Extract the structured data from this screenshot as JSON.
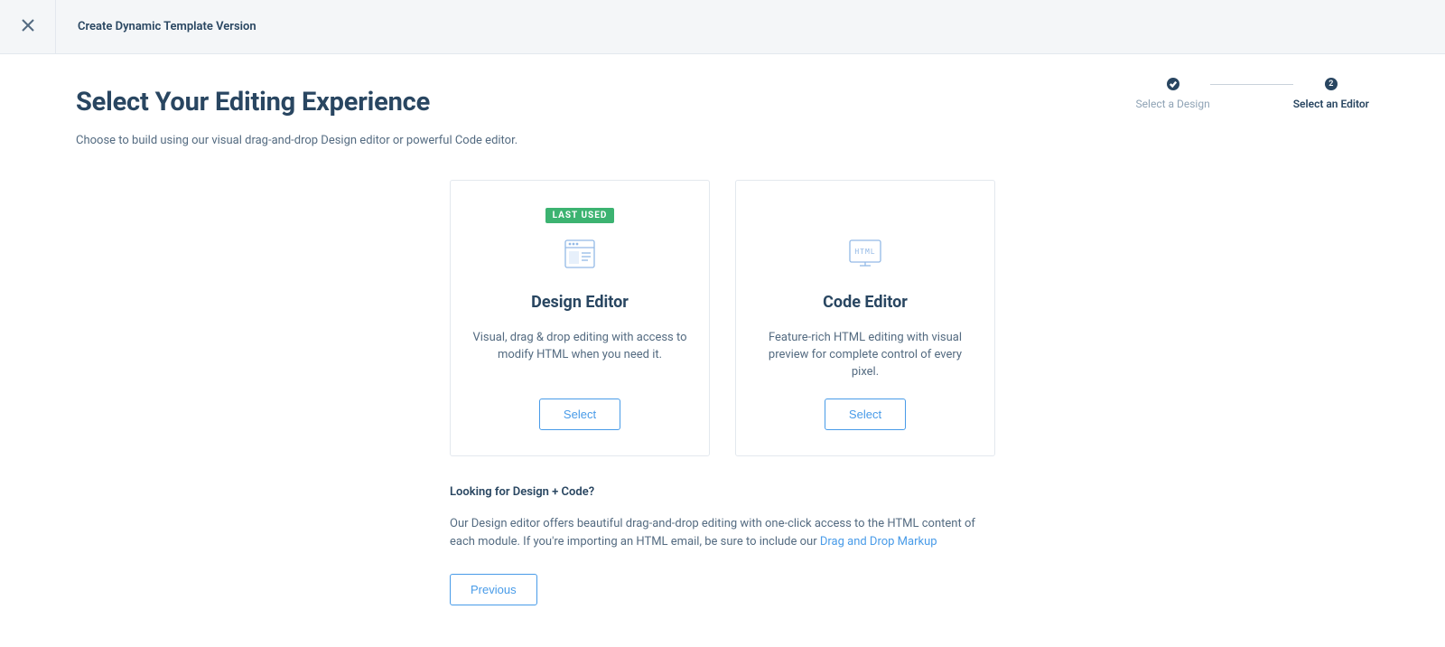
{
  "topbar": {
    "title": "Create Dynamic Template Version"
  },
  "page": {
    "heading": "Select Your Editing Experience",
    "subheading": "Choose to build using our visual drag-and-drop Design editor or powerful Code editor."
  },
  "stepper": {
    "step1": {
      "label": "Select a Design",
      "status": "done"
    },
    "step2": {
      "label": "Select an Editor",
      "status": "current",
      "number": "2"
    }
  },
  "cards": {
    "design": {
      "badge": "LAST USED",
      "title": "Design Editor",
      "description": "Visual, drag & drop editing with access to modify HTML when you need it.",
      "button": "Select"
    },
    "code": {
      "title": "Code Editor",
      "description": "Feature-rich HTML editing with visual preview for complete control of every pixel.",
      "button": "Select",
      "icon_text": "HTML"
    }
  },
  "info": {
    "heading": "Looking for Design + Code?",
    "body_pre": "Our Design editor offers beautiful drag-and-drop editing with one-click access to the HTML content of each module. If you're importing an HTML email, be sure to include our ",
    "link_text": "Drag and Drop Markup"
  },
  "nav": {
    "previous": "Previous"
  }
}
